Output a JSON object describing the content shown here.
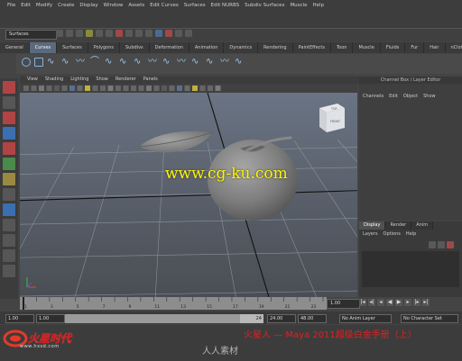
{
  "menubar": {
    "items": [
      "File",
      "Edit",
      "Modify",
      "Create",
      "Display",
      "Window",
      "Assets",
      "Edit Curves",
      "Surfaces",
      "Edit NURBS",
      "Subdiv Surfaces",
      "Muscle",
      "Help"
    ]
  },
  "status_line": {
    "mode_dropdown": "Surfaces"
  },
  "shelf": {
    "tabs": [
      "General",
      "Curves",
      "Surfaces",
      "Polygons",
      "Subdivs",
      "Deformation",
      "Animation",
      "Dynamics",
      "Rendering",
      "PaintEffects",
      "Toon",
      "Muscle",
      "Fluids",
      "Fur",
      "Hair",
      "nCloth"
    ],
    "active_tab": "Curves"
  },
  "viewport": {
    "menus": [
      "View",
      "Shading",
      "Lighting",
      "Show",
      "Renderer",
      "Panels"
    ],
    "viewcube": {
      "top": "TOP",
      "front": "FRONT"
    }
  },
  "channel_box": {
    "title": "Channel Box / Layer Editor",
    "menus": [
      "Channels",
      "Edit",
      "Object",
      "Show"
    ]
  },
  "layer_editor": {
    "tabs": [
      "Display",
      "Render",
      "Anim"
    ],
    "active_tab": "Display",
    "menus": [
      "Layers",
      "Options",
      "Help"
    ]
  },
  "time_slider": {
    "ticks": [
      "1",
      "2",
      "3",
      "4",
      "5",
      "6",
      "7",
      "8",
      "9",
      "10",
      "11",
      "12",
      "13",
      "14",
      "15",
      "16",
      "17",
      "18",
      "19",
      "20",
      "21",
      "22",
      "23",
      "24"
    ],
    "current_frame": "1.00"
  },
  "range_slider": {
    "start_time": "1.00",
    "start_range": "1.00",
    "range_bar_end": "24",
    "end_range": "24.00",
    "end_time": "48.00",
    "anim_layer": "No Anim Layer",
    "character_set": "No Character Set"
  },
  "watermarks": {
    "cg_ku": "www.cg-ku.com",
    "chinese_title": "火星人 — Maya 2011超级白金手册（上）",
    "logo_brand": "火星时代",
    "logo_url": "www.hxsd.com",
    "renren": "人人素材"
  },
  "colors": {
    "accent_tab": "#5a6a7e",
    "watermark_yellow": "#fff700",
    "watermark_red": "#e02020"
  }
}
